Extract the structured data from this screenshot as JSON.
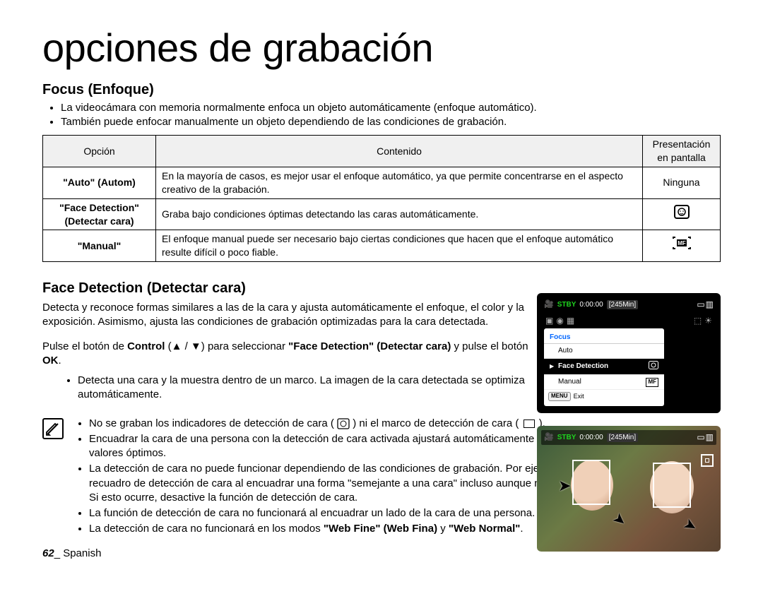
{
  "title": "opciones de grabación",
  "focus": {
    "heading": "Focus (Enfoque)",
    "bullets": [
      "La videocámara con memoria normalmente enfoca un objeto automáticamente (enfoque automático).",
      "También puede enfocar manualmente un objeto dependiendo de las condiciones de grabación."
    ],
    "table": {
      "head_option": "Opción",
      "head_content": "Contenido",
      "head_display": "Presentación en pantalla",
      "rows": [
        {
          "option": "\"Auto\" (Autom)",
          "content": "En la mayoría de casos, es mejor usar el enfoque automático, ya que permite concentrarse en el aspecto creativo de la grabación.",
          "display": "Ninguna",
          "icon": ""
        },
        {
          "option": "\"Face Detection\" (Detectar cara)",
          "content": "Graba bajo condiciones óptimas detectando las caras automáticamente.",
          "display": "",
          "icon": "face"
        },
        {
          "option": "\"Manual\"",
          "content": "El enfoque manual puede ser necesario bajo ciertas condiciones que hacen que el enfoque automático resulte difícil o poco fiable.",
          "display": "",
          "icon": "mf"
        }
      ]
    }
  },
  "face_detection": {
    "heading": "Face Detection (Detectar cara)",
    "desc": "Detecta y reconoce formas similares a las de la cara y ajusta automáticamente el enfoque, el color y la exposición. Asimismo, ajusta las condiciones de grabación optimizadas para la cara detectada.",
    "control_prefix": "Pulse el botón de ",
    "control_bold": "Control",
    "control_arrows": " (▲ / ▼) para seleccionar ",
    "control_fd": "\"Face Detection\" (Detectar cara)",
    "control_mid": " y pulse el botón ",
    "control_ok": "OK",
    "control_suffix": ".",
    "sub_bullet": "Detecta una cara y la muestra dentro de un marco. La imagen de la cara detectada se optimiza automáticamente.",
    "notes": [
      {
        "pre": "No se graban los indicadores de detección de cara ( ",
        "icon1": true,
        "mid": " ) ni el marco de detección de cara ( ",
        "icon2": true,
        "post": " )."
      },
      {
        "text": "Encuadrar la cara de una persona con la detección de cara activada ajustará automáticamente el enfoque y la exposición a los valores óptimos."
      },
      {
        "text": "La detección de cara no puede funcionar dependiendo de las condiciones de grabación. Por ejemplo, es posible que aparezca el recuadro de detección de cara al encuadrar una forma \"semejante a una cara\" incluso aunque no se trate de la cara de una persona. Si esto ocurre, desactive la función de detección de cara."
      },
      {
        "text": "La función de detección de cara no funcionará al encuadrar un lado de la cara de una persona. Debe encuadrar toda la cabeza."
      },
      {
        "pre": "La detección de cara no funcionará en los modos ",
        "b1": "\"Web Fine\" (Web Fina)",
        "mid2": " y ",
        "b2": "\"Web Normal\"",
        "post2": "."
      }
    ]
  },
  "lcd_menu": {
    "stby": "STBY",
    "timecode": "0:00:00",
    "duration": "[245Min]",
    "menu_title": "Focus",
    "items": [
      {
        "label": "Auto",
        "selected": false,
        "icon": ""
      },
      {
        "label": "Face Detection",
        "selected": true,
        "icon": "face"
      },
      {
        "label": "Manual",
        "selected": false,
        "icon": "mf"
      }
    ],
    "menu_badge": "MENU",
    "exit_label": "Exit"
  },
  "lcd_preview": {
    "stby": "STBY",
    "timecode": "0:00:00",
    "duration": "[245Min]"
  },
  "note_icon_glyph": "✎",
  "footer": {
    "page": "62",
    "sep": "_ ",
    "lang": "Spanish"
  },
  "icons": {
    "face_glyph": "⊡",
    "mf_glyph": "MF"
  }
}
